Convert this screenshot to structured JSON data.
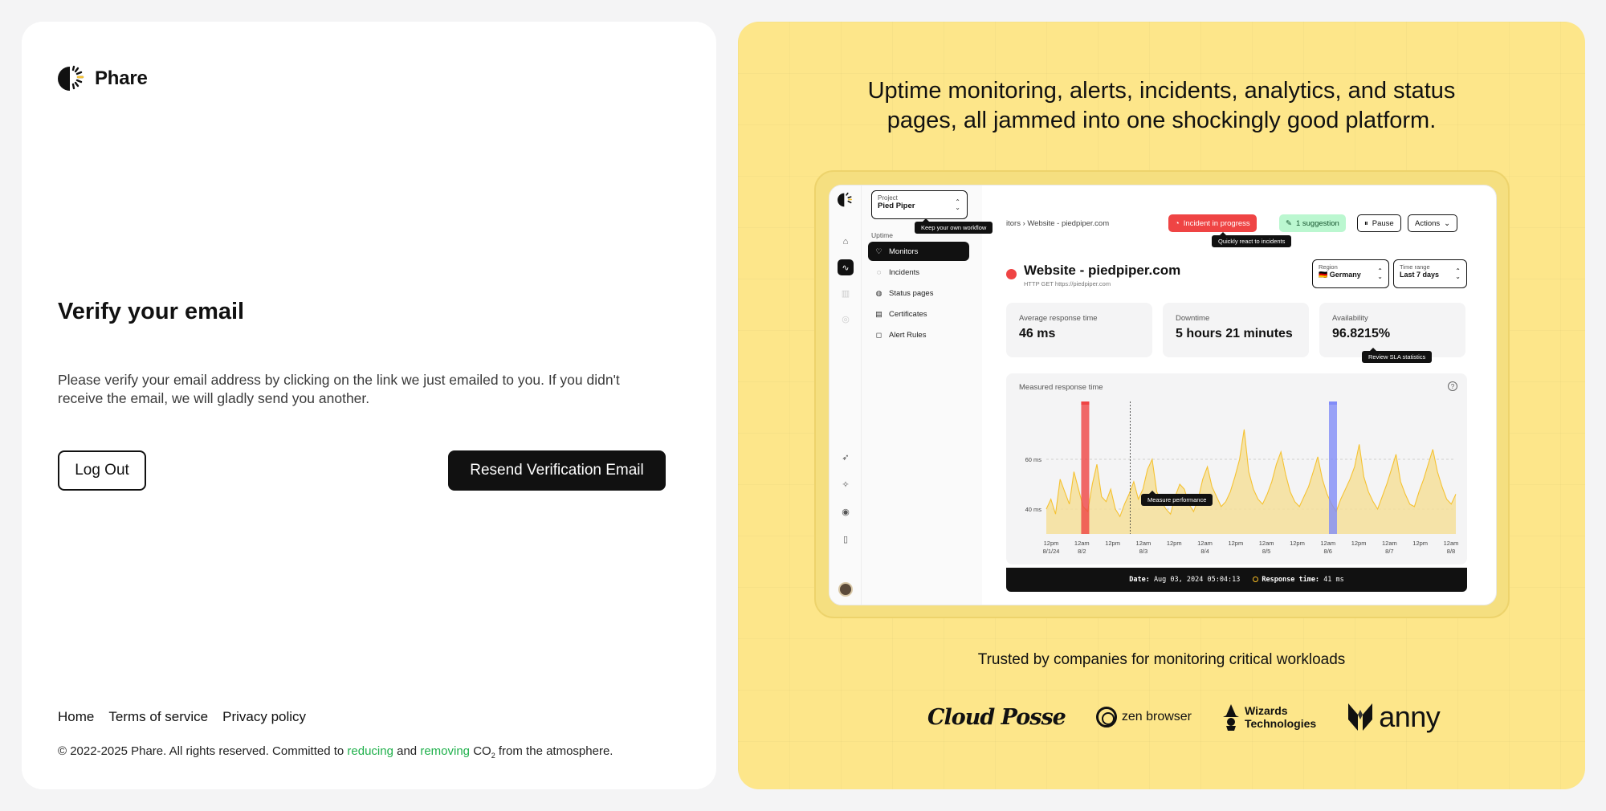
{
  "brand": {
    "name": "Phare"
  },
  "verify": {
    "title": "Verify your email",
    "description": "Please verify your email address by clicking on the link we just emailed to you. If you didn't receive the email, we will gladly send you another.",
    "logout_label": "Log Out",
    "resend_label": "Resend Verification Email"
  },
  "footer": {
    "links": [
      "Home",
      "Terms of service",
      "Privacy policy"
    ],
    "copyright_prefix": "© 2022-2025 Phare. All rights reserved. Committed to ",
    "reducing": "reducing",
    "and": " and ",
    "removing": "removing",
    "co2": "CO",
    "co2_sub": "2",
    "copyright_suffix": " from the atmosphere."
  },
  "promo": {
    "headline_line1": "Uptime monitoring, alerts, incidents, analytics, and status",
    "headline_line2": "pages, all jammed into one shockingly good platform.",
    "trusted": "Trusted by companies for monitoring critical workloads",
    "logos": {
      "cloudposse": "Cloud Posse",
      "zen": "zen browser",
      "wizards_1": "Wizards",
      "wizards_2": "Technologies",
      "anny": "anny"
    }
  },
  "mock": {
    "project_label": "Project",
    "project_name": "Pied Piper",
    "tip_workflow": "Keep your own workflow",
    "section": "Uptime",
    "nav": [
      "Monitors",
      "Incidents",
      "Status pages",
      "Certificates",
      "Alert Rules"
    ],
    "breadcrumb": "itors  ›  Website - piedpiper.com",
    "incident_pill": "Incident in progress",
    "tip_incident": "Quickly react to incidents",
    "suggestion_pill": "1 suggestion",
    "pause": "Pause",
    "actions": "Actions",
    "site_title": "Website - piedpiper.com",
    "site_sub": "HTTP GET https://piedpiper.com",
    "region_label": "Region",
    "region_value": "🇩🇪 Germany",
    "range_label": "Time range",
    "range_value": "Last 7 days",
    "stats": [
      {
        "label": "Average response time",
        "value": "46 ms"
      },
      {
        "label": "Downtime",
        "value": "5 hours 21 minutes"
      },
      {
        "label": "Availability",
        "value": "96.8215%"
      }
    ],
    "tip_sla": "Review SLA statistics",
    "chart_title": "Measured response time",
    "tip_perf": "Measure performance",
    "footer_date_label": "Date:",
    "footer_date": "Aug 03, 2024 05:04:13",
    "footer_resp_label": "Response time:",
    "footer_resp": "41 ms"
  },
  "chart_data": {
    "type": "area",
    "title": "Measured response time",
    "y_ticks": [
      "60 ms",
      "40 ms"
    ],
    "x_ticks": [
      [
        "12pm",
        "8/1/24"
      ],
      [
        "12am",
        "8/2"
      ],
      [
        "12pm",
        ""
      ],
      [
        "12am",
        "8/3"
      ],
      [
        "12pm",
        ""
      ],
      [
        "12am",
        "8/4"
      ],
      [
        "12pm",
        ""
      ],
      [
        "12am",
        "8/5"
      ],
      [
        "12pm",
        ""
      ],
      [
        "12am",
        "8/6"
      ],
      [
        "12pm",
        ""
      ],
      [
        "12am",
        "8/7"
      ],
      [
        "12pm",
        ""
      ],
      [
        "12am",
        "8/8"
      ]
    ],
    "series": [
      {
        "values": [
          40,
          44,
          38,
          52,
          47,
          42,
          55,
          48,
          41,
          39,
          50,
          58,
          45,
          43,
          48,
          40,
          37,
          42,
          46,
          51,
          44,
          48,
          56,
          60,
          47,
          43,
          40,
          38,
          45,
          50,
          48,
          42,
          39,
          44,
          52,
          57,
          49,
          45,
          41,
          43,
          47,
          53,
          60,
          72,
          55,
          48,
          44,
          42,
          46,
          51,
          58,
          63,
          54,
          47,
          43,
          41,
          45,
          49,
          55,
          61,
          52,
          46,
          42,
          39,
          44,
          48,
          52,
          57,
          66,
          53,
          47,
          43,
          40,
          45,
          50,
          56,
          62,
          51,
          46,
          42,
          41,
          47,
          52,
          58,
          64,
          55,
          49,
          44,
          42,
          46
        ]
      }
    ],
    "incident_bands": [
      {
        "position": 0.095,
        "color": "#ef4444"
      },
      {
        "position": 0.7,
        "color": "#818cf8"
      }
    ],
    "ylim": [
      30,
      80
    ],
    "grid": true
  },
  "colors": {
    "accent_yellow": "#fde68a",
    "incident_red": "#ef4444",
    "success_green": "#1fb04b",
    "series_yellow": "#f5c232"
  }
}
